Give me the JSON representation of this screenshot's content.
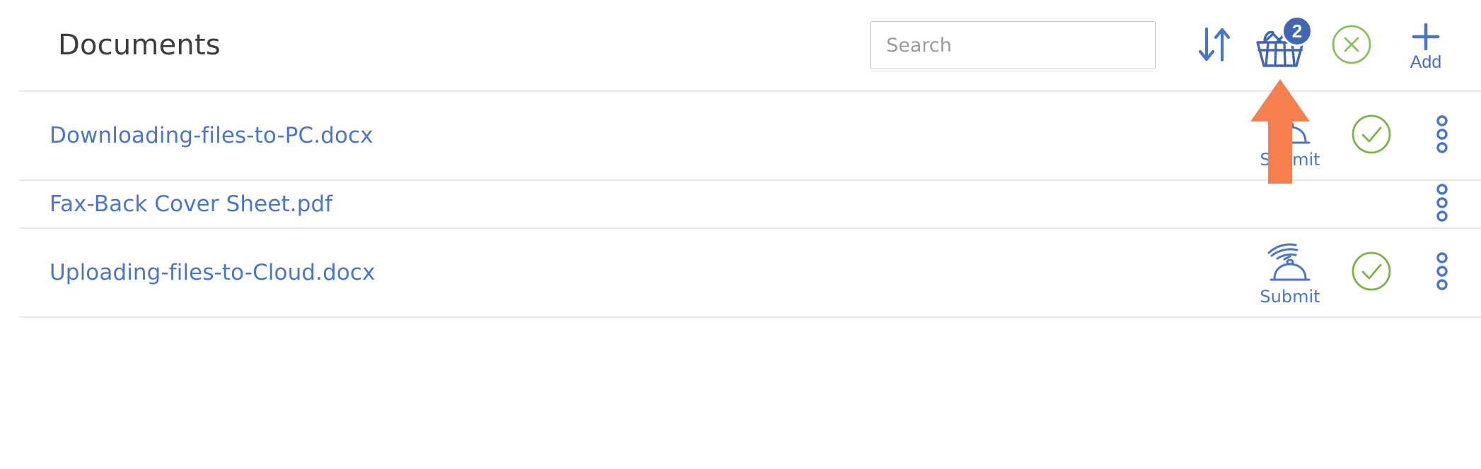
{
  "header": {
    "title": "Documents",
    "search": {
      "placeholder": "Search",
      "value": ""
    },
    "tools": [
      {
        "name": "sort-button",
        "icon": "sort-arrows-icon",
        "label": ""
      },
      {
        "name": "basket-button",
        "icon": "basket-icon",
        "label": "",
        "badge": "2"
      },
      {
        "name": "clear-button",
        "icon": "circle-x-icon",
        "label": ""
      },
      {
        "name": "add-button",
        "icon": "plus-icon",
        "label": "Add"
      }
    ],
    "basket_badge_count": "2",
    "add_label": "Add"
  },
  "rows": [
    {
      "file_name": "Downloading-files-to-PC.docx",
      "submit_label": "Submit",
      "has_submit": true,
      "has_check": true,
      "has_menu": true
    },
    {
      "file_name": "Fax-Back Cover Sheet.pdf",
      "submit_label": "",
      "has_submit": false,
      "has_check": false,
      "has_menu": true
    },
    {
      "file_name": "Uploading-files-to-Cloud.docx",
      "submit_label": "Submit",
      "has_submit": true,
      "has_check": true,
      "has_menu": true
    }
  ],
  "annotation": {
    "arrow": "orange-up-arrow",
    "points_at": "basket-button"
  },
  "colors": {
    "link_blue": "#4a76c4",
    "icon_blue": "#4267b2",
    "badge_blue": "#4267b2",
    "check_green": "#7cb342",
    "clear_green": "#8bbf5c",
    "arrow_orange": "#f57f4f",
    "title_gray": "#3d3d3d",
    "divider_gray": "#e6e6e6",
    "placeholder_gray": "#9a9a9a"
  }
}
